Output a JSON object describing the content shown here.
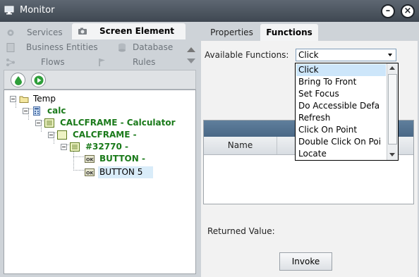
{
  "window": {
    "title": "Monitor",
    "minimize_icon": "minimize-icon",
    "close_icon": "close-icon"
  },
  "left_tabs": [
    {
      "label": "Services",
      "icon": "gear-icon"
    },
    {
      "label": "Screen Element",
      "icon": "camera-icon",
      "active": true
    },
    {
      "label": "Business Entities",
      "icon": "document-icon"
    },
    {
      "label": "Database",
      "icon": "database-icon"
    },
    {
      "label": "Flows",
      "icon": "flow-icon"
    },
    {
      "label": "Rules",
      "icon": "flag-icon"
    }
  ],
  "toolbar": {
    "capture_icon": "droplet-icon",
    "play_icon": "play-icon"
  },
  "tree": [
    {
      "label": "Temp",
      "level": 0,
      "style": "normal",
      "icon": "folder-icon"
    },
    {
      "label": "calc",
      "level": 1,
      "style": "green",
      "icon": "calculator-icon"
    },
    {
      "label": "CALCFRAME - Calculator",
      "level": 2,
      "style": "green",
      "icon": "window-icon"
    },
    {
      "label": "CALCFRAME -",
      "level": 3,
      "style": "green",
      "icon": "frame-icon"
    },
    {
      "label": "#32770 -",
      "level": 4,
      "style": "green",
      "icon": "window-icon"
    },
    {
      "label": "BUTTON -",
      "level": 5,
      "style": "green",
      "icon": "ok-button-icon"
    },
    {
      "label": "BUTTON 5",
      "level": 5,
      "style": "selected",
      "icon": "ok-button-icon"
    }
  ],
  "right_tabs": [
    {
      "label": "Properties"
    },
    {
      "label": "Functions",
      "active": true
    }
  ],
  "functions": {
    "available_label": "Available Functions:",
    "selected": "Click",
    "options": [
      "Click",
      "Bring To Front",
      "Set Focus",
      "Do Accessible Defa",
      "Refresh",
      "Click On Point",
      "Double Click On Poi",
      "Locate"
    ],
    "params_header": "Pa",
    "columns": [
      "Name",
      "T"
    ],
    "returned_value_label": "Returned Value:",
    "invoke_label": "Invoke"
  },
  "colors": {
    "accent_green": "#1a7a1a",
    "selection": "#d9ecf9",
    "title_bar": "#4f5862"
  }
}
